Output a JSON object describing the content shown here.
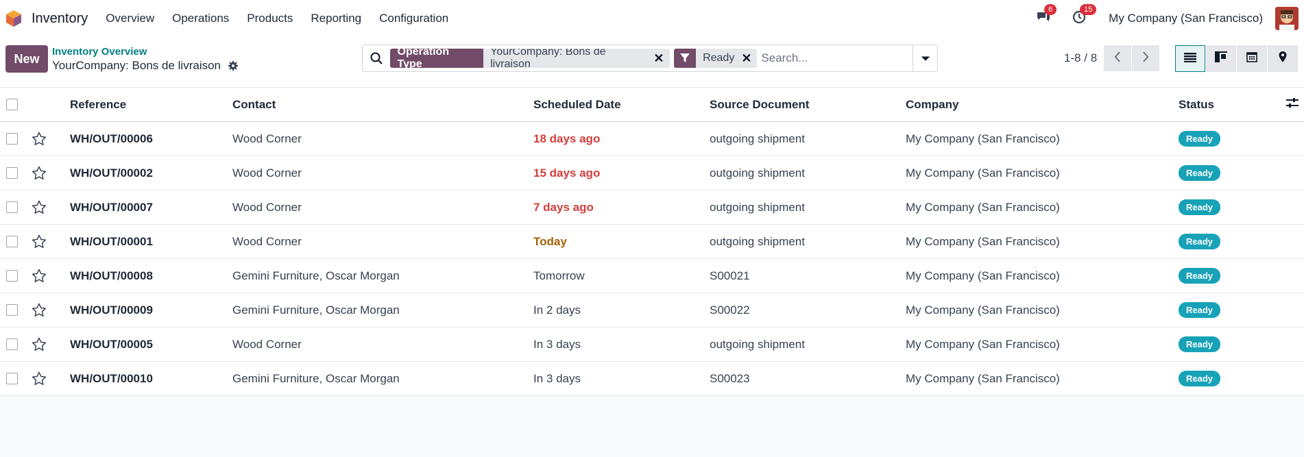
{
  "navbar": {
    "app_name": "Inventory",
    "menu": [
      "Overview",
      "Operations",
      "Products",
      "Reporting",
      "Configuration"
    ],
    "messages_count": "6",
    "activities_count": "15",
    "company": "My Company (San Francisco)"
  },
  "control_panel": {
    "new_label": "New",
    "breadcrumb_parent": "Inventory Overview",
    "breadcrumb_current": "YourCompany: Bons de livraison",
    "facets": [
      {
        "label": "Operation Type",
        "value": "YourCompany: Bons de livraison"
      },
      {
        "icon": "filter-icon",
        "value": "Ready"
      }
    ],
    "search_placeholder": "Search...",
    "pager": "1-8 / 8"
  },
  "table": {
    "headers": [
      "Reference",
      "Contact",
      "Scheduled Date",
      "Source Document",
      "Company",
      "Status"
    ],
    "rows": [
      {
        "reference": "WH/OUT/00006",
        "contact": "Wood Corner",
        "date": "18 days ago",
        "date_state": "late",
        "source": "outgoing shipment",
        "company": "My Company (San Francisco)",
        "status": "Ready"
      },
      {
        "reference": "WH/OUT/00002",
        "contact": "Wood Corner",
        "date": "15 days ago",
        "date_state": "late",
        "source": "outgoing shipment",
        "company": "My Company (San Francisco)",
        "status": "Ready"
      },
      {
        "reference": "WH/OUT/00007",
        "contact": "Wood Corner",
        "date": "7 days ago",
        "date_state": "late",
        "source": "outgoing shipment",
        "company": "My Company (San Francisco)",
        "status": "Ready"
      },
      {
        "reference": "WH/OUT/00001",
        "contact": "Wood Corner",
        "date": "Today",
        "date_state": "today",
        "source": "outgoing shipment",
        "company": "My Company (San Francisco)",
        "status": "Ready"
      },
      {
        "reference": "WH/OUT/00008",
        "contact": "Gemini Furniture, Oscar Morgan",
        "date": "Tomorrow",
        "date_state": "normal",
        "source": "S00021",
        "company": "My Company (San Francisco)",
        "status": "Ready"
      },
      {
        "reference": "WH/OUT/00009",
        "contact": "Gemini Furniture, Oscar Morgan",
        "date": "In 2 days",
        "date_state": "normal",
        "source": "S00022",
        "company": "My Company (San Francisco)",
        "status": "Ready"
      },
      {
        "reference": "WH/OUT/00005",
        "contact": "Wood Corner",
        "date": "In 3 days",
        "date_state": "normal",
        "source": "outgoing shipment",
        "company": "My Company (San Francisco)",
        "status": "Ready"
      },
      {
        "reference": "WH/OUT/00010",
        "contact": "Gemini Furniture, Oscar Morgan",
        "date": "In 3 days",
        "date_state": "normal",
        "source": "S00023",
        "company": "My Company (San Francisco)",
        "status": "Ready"
      }
    ]
  },
  "colors": {
    "brand": "#714b67",
    "link": "#017e84",
    "late": "#d23f3a",
    "today": "#a16207",
    "status_ready": "#17a2b8",
    "badge_red": "#dc2f3d"
  }
}
